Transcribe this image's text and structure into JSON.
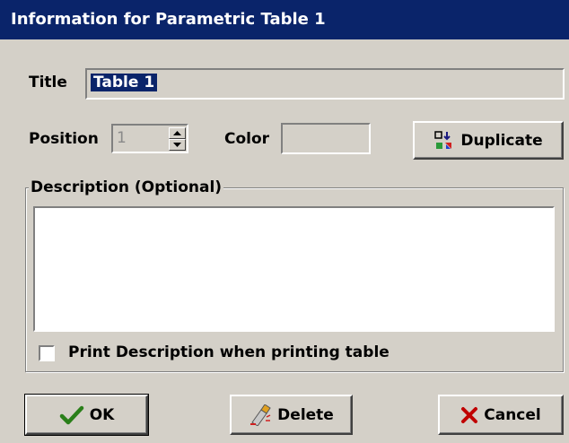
{
  "window": {
    "title": "Information for Parametric Table 1"
  },
  "title_field": {
    "label": "Title",
    "value": "Table 1"
  },
  "position_field": {
    "label": "Position",
    "value": "1"
  },
  "color_field": {
    "label": "Color",
    "value": ""
  },
  "duplicate_button": {
    "label": "Duplicate",
    "icon": "duplicate-icon"
  },
  "description": {
    "legend": "Description (Optional)",
    "value": ""
  },
  "print_description": {
    "label": "Print Description when printing table",
    "checked": false
  },
  "buttons": {
    "ok": {
      "label": "OK",
      "icon": "checkmark-icon",
      "color": "#2a7f1a"
    },
    "delete": {
      "label": "Delete",
      "icon": "eraser-icon"
    },
    "cancel": {
      "label": "Cancel",
      "icon": "x-icon",
      "color": "#c00000"
    }
  }
}
